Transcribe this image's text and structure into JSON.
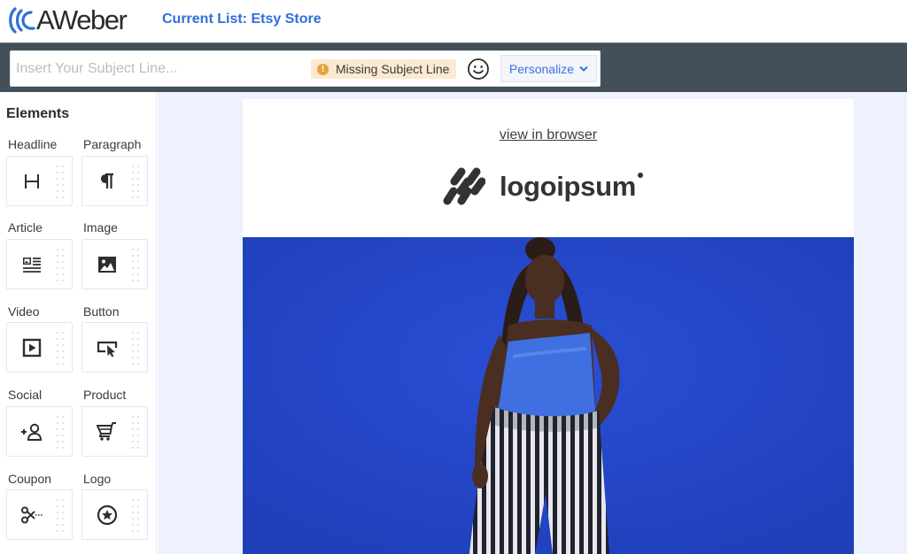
{
  "app": {
    "brand_name": "AWeber",
    "current_list": "Current List: Etsy Store",
    "brand_color": "#2f6fdc"
  },
  "subject": {
    "placeholder": "Insert Your Subject Line...",
    "value": "",
    "warning_badge": "Missing Subject Line",
    "warning_color": "#e8a33c",
    "emoji_icon": "smiley-face-icon",
    "personalize_label": "Personalize"
  },
  "sidebar": {
    "title": "Elements",
    "items": [
      {
        "label": "Headline",
        "icon": "headline-h-icon"
      },
      {
        "label": "Paragraph",
        "icon": "pilcrow-icon"
      },
      {
        "label": "Article",
        "icon": "article-icon"
      },
      {
        "label": "Image",
        "icon": "image-icon"
      },
      {
        "label": "Video",
        "icon": "video-play-icon"
      },
      {
        "label": "Button",
        "icon": "button-cursor-icon"
      },
      {
        "label": "Social",
        "icon": "add-person-icon"
      },
      {
        "label": "Product",
        "icon": "shopping-cart-icon"
      },
      {
        "label": "Coupon",
        "icon": "scissors-icon"
      },
      {
        "label": "Logo",
        "icon": "star-badge-icon"
      }
    ]
  },
  "email": {
    "view_in_browser": "view in browser",
    "logo_text": "logoipsum",
    "hero_background": "#2346c8",
    "hero_alt": "Woman in blue top and striped pants standing against a blue wall"
  }
}
